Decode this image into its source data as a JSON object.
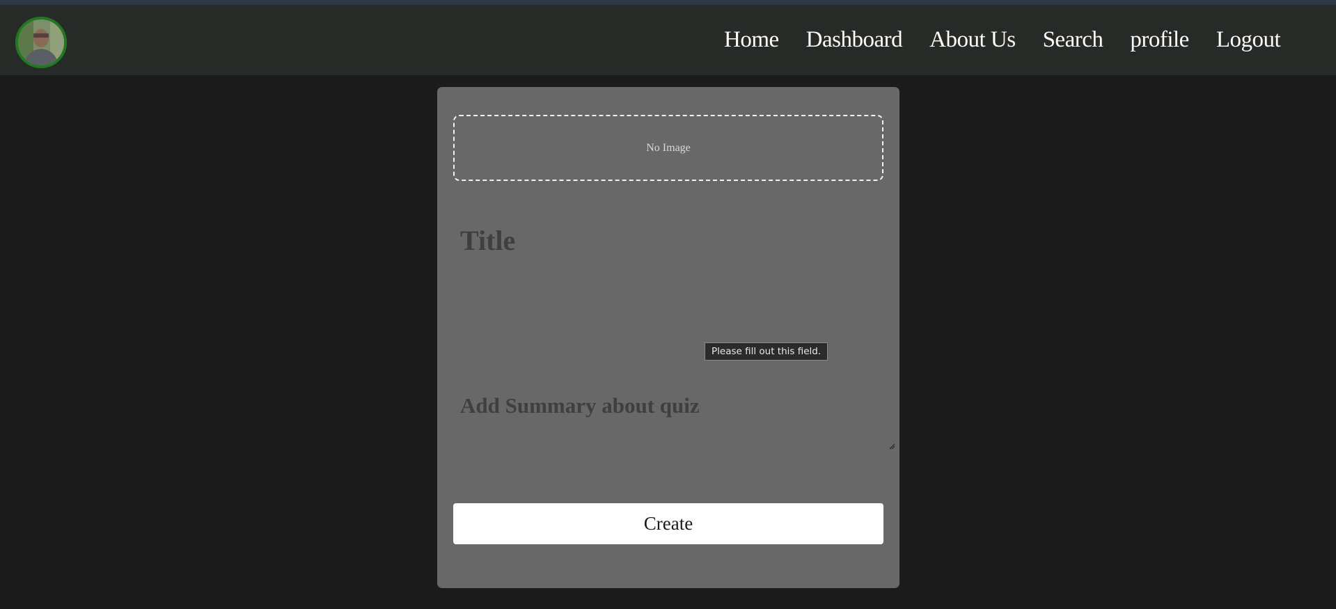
{
  "nav": {
    "avatar_alt": "user avatar photo",
    "links": [
      {
        "label": "Home"
      },
      {
        "label": "Dashboard"
      },
      {
        "label": "About Us"
      },
      {
        "label": "Search"
      },
      {
        "label": "profile"
      },
      {
        "label": "Logout"
      }
    ]
  },
  "form": {
    "image_placeholder": "No Image",
    "title_placeholder": "Title",
    "title_value": "",
    "summary_placeholder": "Add Summary about quiz",
    "summary_value": "",
    "validation_tooltip": "Please fill out this field.",
    "create_label": "Create"
  },
  "colors": {
    "page_background": "#1b1b1b",
    "navbar_background": "#272b28",
    "card_background": "#686868",
    "avatar_border": "#1f7a1f",
    "button_background": "#ffffff"
  }
}
